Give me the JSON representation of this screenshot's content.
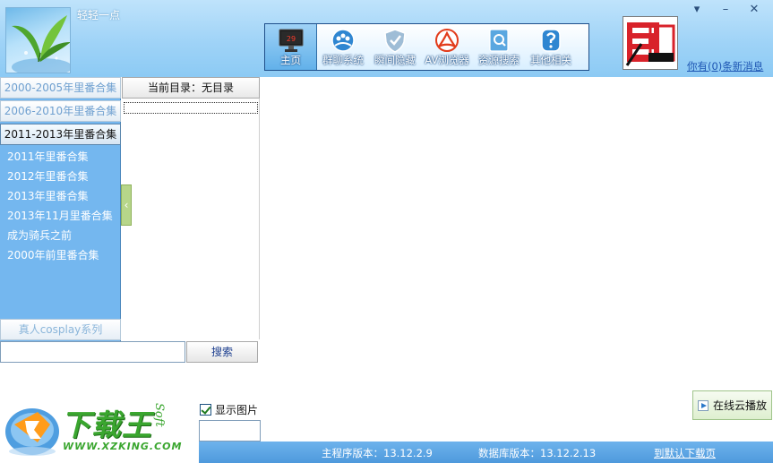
{
  "window": {
    "title": "轻轻一点",
    "menu_glyph": "▾",
    "minimize_glyph": "–",
    "close_glyph": "✕"
  },
  "toolbar": {
    "items": [
      {
        "label": "主页",
        "icon": "monitor-icon",
        "active": true
      },
      {
        "label": "群聊系统",
        "icon": "chat-group-icon"
      },
      {
        "label": "瞬间隐藏",
        "icon": "shield-icon"
      },
      {
        "label": "AV浏览器",
        "icon": "browser-icon"
      },
      {
        "label": "资源搜索",
        "icon": "search-icon"
      },
      {
        "label": "其他相关",
        "icon": "info-icon"
      }
    ],
    "monitor_screen_text": "29"
  },
  "header": {
    "messages_link": "你有(0)条新消息"
  },
  "categories": {
    "headers": [
      {
        "label": "2000-2005年里番合集",
        "active": false
      },
      {
        "label": "2006-2010年里番合集",
        "active": false
      },
      {
        "label": "2011-2013年里番合集",
        "active": true
      }
    ],
    "items": [
      "2011年里番合集",
      "2012年里番合集",
      "2013年里番合集",
      "2013年11月里番合集",
      "成为骑兵之前",
      "2000年前里番合集"
    ],
    "footer": "真人cosplay系列"
  },
  "directory": {
    "header": "当前目录：无目录",
    "collapse_glyph": "‹"
  },
  "search": {
    "button_label": "搜索",
    "placeholder": ""
  },
  "options": {
    "show_images_label": "显示图片",
    "show_images_checked": true
  },
  "content": {
    "cloud_play_label": "在线云播放"
  },
  "watermark": {
    "cn": "下载王",
    "soft": "Soft",
    "url": "WWW.XZKING.COM"
  },
  "status": {
    "main_version_label": "主程序版本：13.12.2.9",
    "db_version_label": "数据库版本：13.12.2.13",
    "download_link": "到默认下载页"
  },
  "colors": {
    "header_blue": "#9fd3f7",
    "panel_blue": "#74b7ef",
    "status_blue": "#4e99dc",
    "link_blue": "#1d55b3",
    "watermark_green": "#3aa62f"
  }
}
